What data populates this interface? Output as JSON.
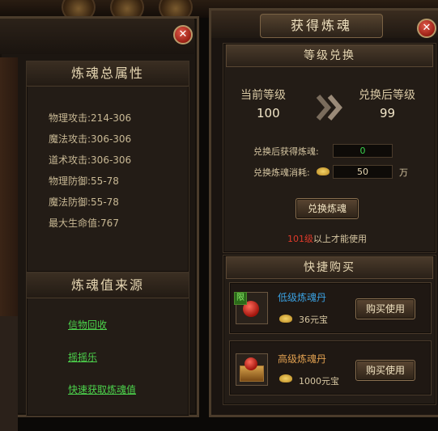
{
  "left": {
    "attr_title": "炼魂总属性",
    "stats": [
      {
        "label": "物理攻击:",
        "value": "214-306"
      },
      {
        "label": "魔法攻击:",
        "value": "306-306"
      },
      {
        "label": "道术攻击:",
        "value": "306-306"
      },
      {
        "label": "物理防御:",
        "value": "55-78"
      },
      {
        "label": "魔法防御:",
        "value": "55-78"
      },
      {
        "label": "最大生命值:",
        "value": "767"
      }
    ],
    "source_title": "炼魂值来源",
    "links": [
      "信物回收",
      "摇摇乐",
      "快速获取炼魂值"
    ]
  },
  "right": {
    "title": "获得炼魂",
    "exchange_title": "等级兑换",
    "current_label": "当前等级",
    "current_value": "100",
    "after_label": "兑换后等级",
    "after_value": "99",
    "gain_label": "兑换后获得炼魂:",
    "gain_value": "0",
    "cost_label": "兑换炼魂消耗:",
    "cost_value": "50",
    "cost_unit": "万",
    "exchange_button": "兑换炼魂",
    "req_level": "101级",
    "req_text": "以上才能使用",
    "shop_title": "快捷购买",
    "items": [
      {
        "name": "低级炼魂丹",
        "price": "36元宝",
        "badge": "限",
        "button": "购买使用"
      },
      {
        "name": "高级炼魂丹",
        "price": "1000元宝",
        "button": "购买使用"
      }
    ]
  },
  "colors": {
    "link": "#4cd24c",
    "item_low": "#3aa0e0",
    "item_high": "#e0a050",
    "req_level": "#e03a2a",
    "gain_value": "#3ad24c"
  }
}
